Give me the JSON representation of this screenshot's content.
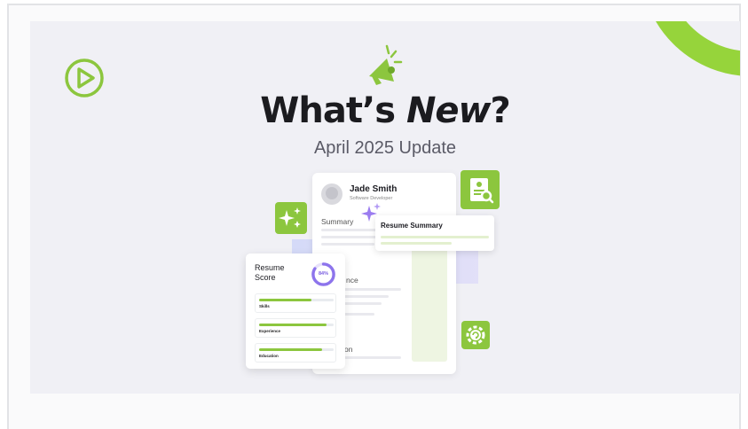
{
  "banner": {
    "title_part1": "What’s ",
    "title_part2": "New",
    "title_part3": "?",
    "subtitle": "April 2025 Update",
    "logo_icon": "play-circle-icon",
    "megaphone_icon": "megaphone-icon",
    "accent_color": "#8cc63e"
  },
  "resume": {
    "name": "Jade Smith",
    "role": "Software Developer",
    "sections": [
      "Summary",
      "nce",
      "on"
    ]
  },
  "summary_card": {
    "title": "Resume Summary"
  },
  "score_card": {
    "title": "Resume Score",
    "score": "84%",
    "score_value": 0.84,
    "items": [
      {
        "label": "Skills",
        "value": 0.7
      },
      {
        "label": "Experience",
        "value": 0.9
      },
      {
        "label": "Education",
        "value": 0.85
      }
    ]
  },
  "icons": [
    "sparkles-icon",
    "resume-search-icon",
    "gear-refresh-icon"
  ]
}
